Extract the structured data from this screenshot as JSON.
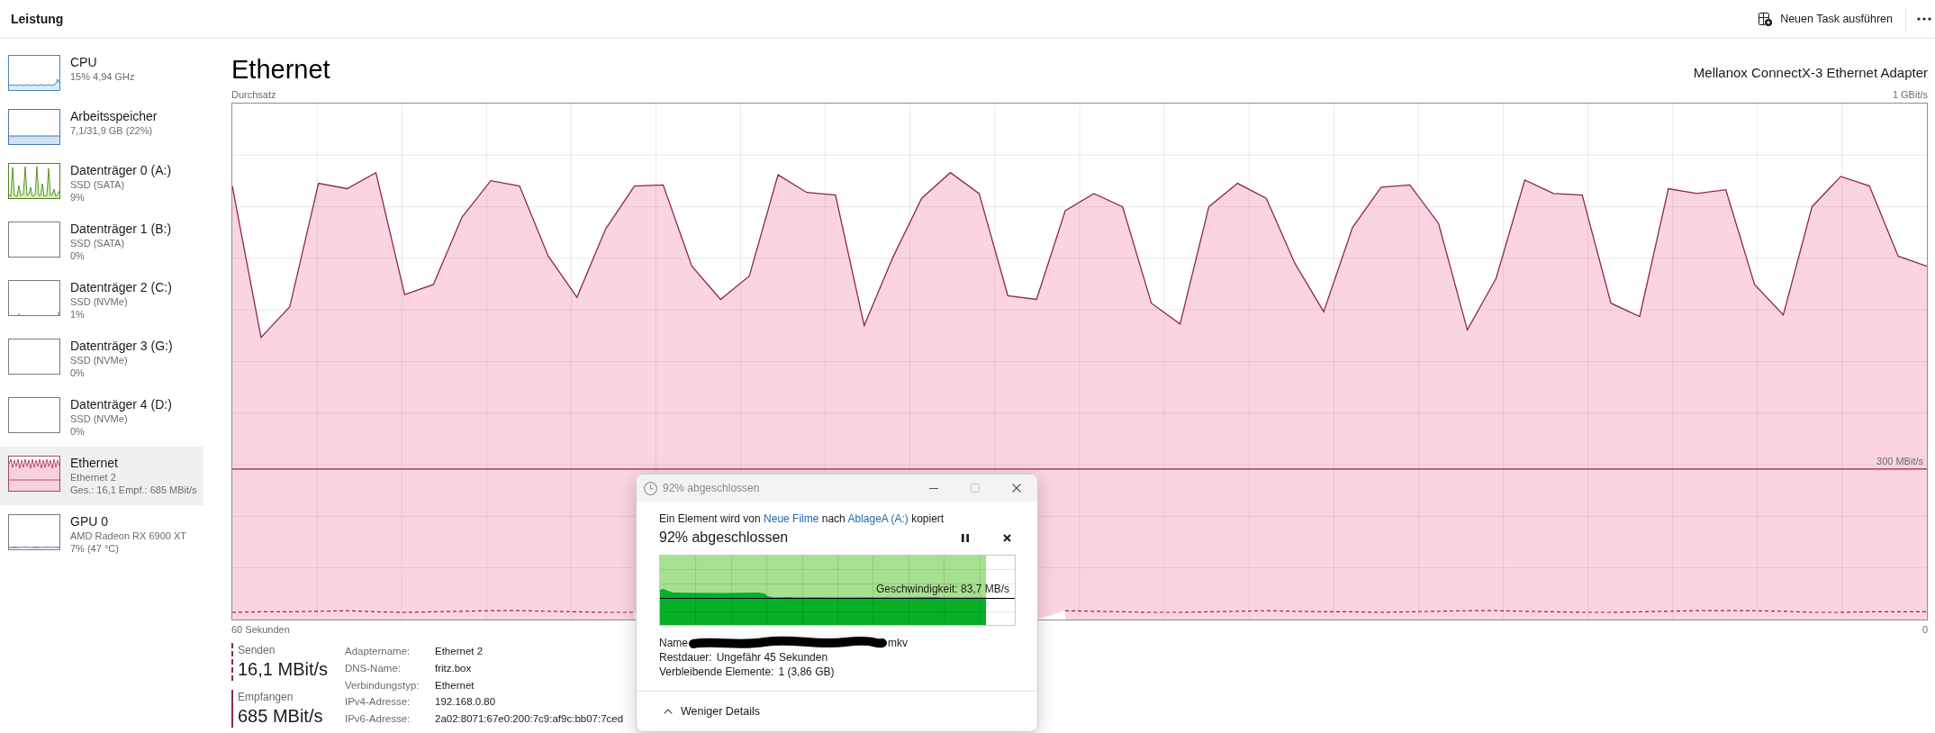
{
  "top_bar": {
    "title": "Leistung",
    "run_task_button": "Neuen Task ausführen"
  },
  "sidebar": {
    "items": [
      {
        "kind": "cpu",
        "title": "CPU",
        "details": [
          "15% 4,94 GHz"
        ],
        "selected": false
      },
      {
        "kind": "memory",
        "title": "Arbeitsspeicher",
        "details": [
          "7,1/31,9 GB (22%)"
        ],
        "selected": false
      },
      {
        "kind": "disk",
        "title": "Datenträger 0 (A:)",
        "details": [
          "SSD (SATA)",
          "9%"
        ],
        "selected": false
      },
      {
        "kind": "idle",
        "title": "Datenträger 1 (B:)",
        "details": [
          "SSD (SATA)",
          "0%"
        ],
        "selected": false
      },
      {
        "kind": "trace",
        "title": "Datenträger 2 (C:)",
        "details": [
          "SSD (NVMe)",
          "1%"
        ],
        "selected": false
      },
      {
        "kind": "idle",
        "title": "Datenträger 3 (G:)",
        "details": [
          "SSD (NVMe)",
          "0%"
        ],
        "selected": false
      },
      {
        "kind": "idle",
        "title": "Datenträger 4 (D:)",
        "details": [
          "SSD (NVMe)",
          "0%"
        ],
        "selected": false
      },
      {
        "kind": "ethernet",
        "title": "Ethernet",
        "details": [
          "Ethernet 2",
          "Ges.: 16,1 Empf.: 685 MBit/s"
        ],
        "selected": true
      },
      {
        "kind": "gpu",
        "title": "GPU 0",
        "details": [
          "AMD Radeon RX 6900 XT",
          "7% (47 °C)"
        ],
        "selected": false
      }
    ]
  },
  "main": {
    "title": "Ethernet",
    "adapter": "Mellanox ConnectX-3 Ethernet Adapter",
    "chart_data": {
      "type": "area",
      "xlabel": "60 Sekunden",
      "ylabel": "Durchsatz",
      "ylim": [
        0,
        1
      ],
      "yticks": [
        {
          "value": 0,
          "label": "0"
        },
        {
          "value": 1,
          "label": "1 GBit/s"
        }
      ],
      "grid": true,
      "series": [
        {
          "name": "Senden",
          "color": "#8e2457",
          "values": [
            0.032,
            0.033,
            0.033,
            0.034,
            0.035,
            0.033,
            0.032,
            0.033,
            0.034,
            0.035,
            0.035,
            0.034,
            0.033,
            0.032,
            0.032,
            null,
            null,
            null,
            null,
            null,
            null,
            null,
            null,
            null,
            null,
            null,
            null,
            null,
            null,
            0.035,
            0.034,
            0.033,
            0.032,
            0.032,
            0.033,
            0.034,
            0.035,
            0.034,
            0.033,
            0.033,
            0.032,
            0.033,
            0.034,
            0.035,
            0.035,
            0.034,
            0.033,
            0.032,
            0.032,
            0.033,
            0.034,
            0.035,
            0.035,
            0.035,
            0.034,
            0.032,
            0.032,
            0.033,
            0.033,
            0.033
          ]
        },
        {
          "name": "Empfangen",
          "color": "#8e2457",
          "values": [
            0.829,
            0.546,
            0.603,
            0.834,
            0.824,
            0.854,
            0.626,
            0.645,
            0.771,
            0.839,
            0.829,
            0.698,
            0.621,
            0.749,
            0.829,
            0.831,
            0.679,
            0.617,
            0.661,
            0.85,
            0.817,
            0.812,
            0.568,
            0.696,
            0.806,
            0.854,
            0.815,
            0.624,
            0.617,
            0.783,
            0.815,
            0.79,
            0.61,
            0.571,
            0.79,
            0.834,
            0.806,
            0.684,
            0.594,
            0.751,
            0.827,
            0.831,
            0.759,
            0.56,
            0.656,
            0.84,
            0.815,
            0.812,
            0.61,
            0.585,
            0.824,
            0.815,
            0.822,
            0.645,
            0.588,
            0.79,
            0.847,
            0.829,
            0.698,
            0.679
          ]
        }
      ],
      "ref_lines": [
        {
          "axis": "y",
          "value": 0.3,
          "label": "300 MBit/s"
        }
      ]
    },
    "stats": [
      {
        "kind": "send",
        "value": "16,1 MBit/s"
      },
      {
        "kind": "receive",
        "value": "685 MBit/s"
      }
    ],
    "properties": [
      {
        "label": "Adaptername:",
        "value": "Ethernet 2"
      },
      {
        "label": "DNS-Name:",
        "value": "fritz.box"
      },
      {
        "label": "Verbindungstyp:",
        "value": "Ethernet"
      },
      {
        "label": "IPv4-Adresse:",
        "value": "192.168.0.80"
      },
      {
        "label": "IPv6-Adresse:",
        "value": "2a02:8071:67e0:200:7c9:af9c:bb07:7ced"
      }
    ]
  },
  "dialog": {
    "title": "92% abgeschlossen",
    "window_buttons": [
      {
        "kind": "minimize",
        "disabled": false
      },
      {
        "kind": "maximize",
        "disabled": true
      },
      {
        "kind": "close",
        "disabled": false
      }
    ],
    "message": [
      {
        "kind": "text",
        "text": "Ein Element wird von "
      },
      {
        "kind": "link",
        "text": "Neue Filme"
      },
      {
        "kind": "text",
        "text": " nach "
      },
      {
        "kind": "link",
        "text": "AblageA (A:)"
      },
      {
        "kind": "text",
        "text": " kopiert"
      }
    ],
    "status": "92% abgeschlossen",
    "actions": [
      {
        "kind": "pause"
      },
      {
        "kind": "cancel"
      }
    ],
    "progress": {
      "level": 0.92,
      "speed": "Geschwindigkeit: 83,7 MB/s"
    },
    "name": {
      "label": "Name",
      "value_end": "mkv"
    },
    "details": [
      {
        "label": "Restdauer:",
        "value": "Ungefähr 45 Sekunden"
      },
      {
        "label": "Verbleibende Elemente:",
        "value": "1 (3,86 GB)"
      }
    ],
    "toggle": "Weniger Details"
  }
}
